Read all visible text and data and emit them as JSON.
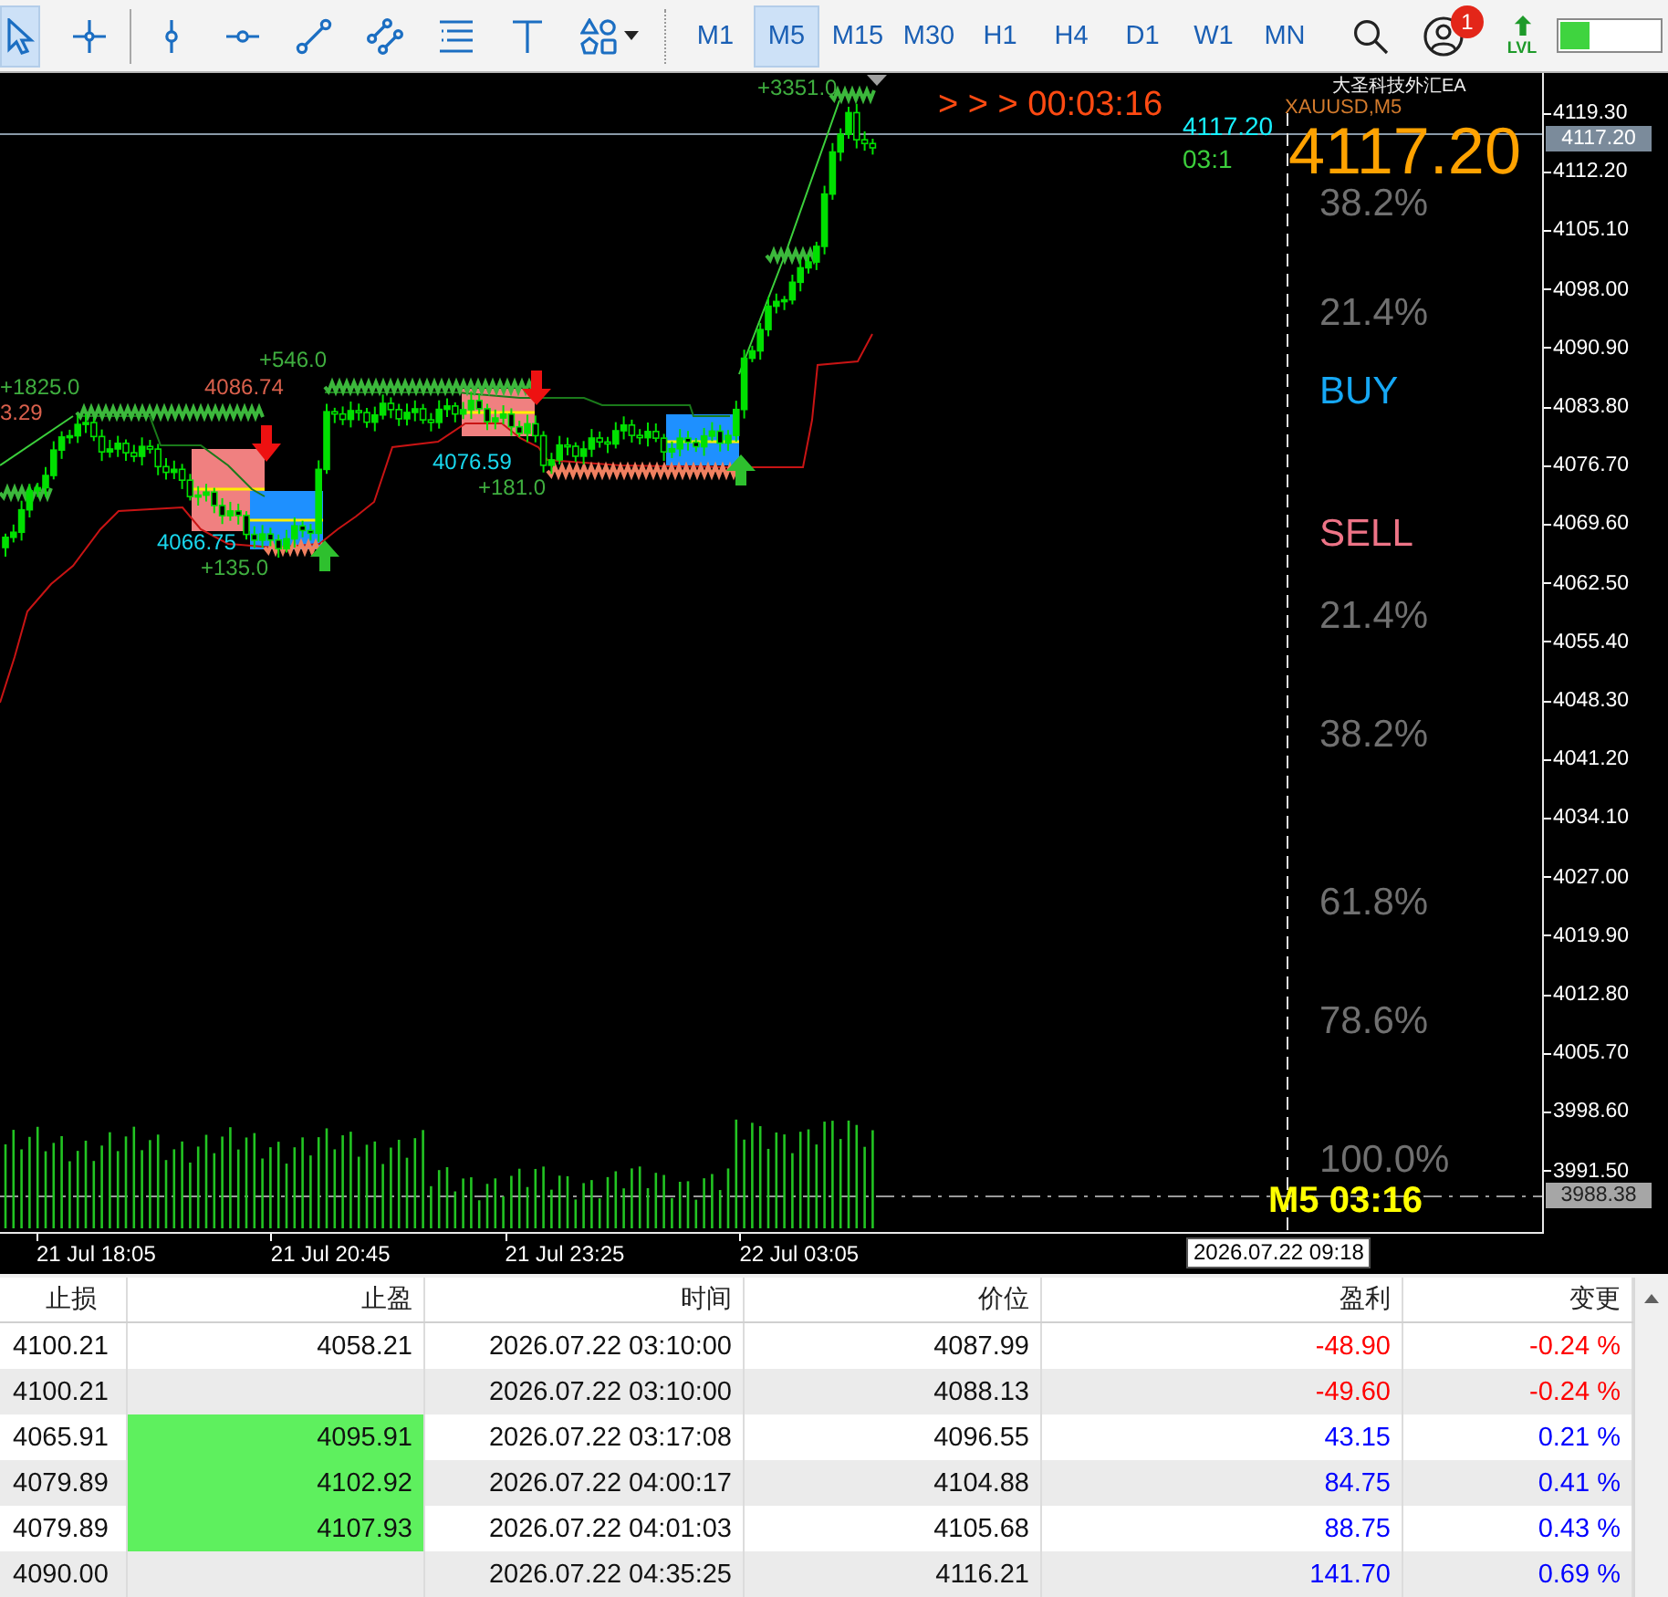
{
  "toolbar": {
    "tools": [
      {
        "kind": "cursor",
        "selected": true
      },
      {
        "kind": "crosshair",
        "selected": false
      },
      {
        "kind": "vertical-line",
        "selected": false
      },
      {
        "kind": "horizontal-line",
        "selected": false
      },
      {
        "kind": "trend-line",
        "selected": false
      },
      {
        "kind": "channel",
        "selected": false
      },
      {
        "kind": "fibonacci",
        "selected": false
      },
      {
        "kind": "text",
        "selected": false
      },
      {
        "kind": "shapes",
        "selected": false
      }
    ],
    "timeframes": [
      {
        "label": "M1",
        "selected": false
      },
      {
        "label": "M5",
        "selected": true
      },
      {
        "label": "M15",
        "selected": false
      },
      {
        "label": "M30",
        "selected": false
      },
      {
        "label": "H1",
        "selected": false
      },
      {
        "label": "H4",
        "selected": false
      },
      {
        "label": "D1",
        "selected": false
      },
      {
        "label": "W1",
        "selected": false
      },
      {
        "label": "MN",
        "selected": false
      }
    ],
    "notification_count": "1",
    "level_button": {
      "label": "LVL"
    },
    "meter": {
      "level": 0.3
    }
  },
  "chart": {
    "countdown": "> > > 00:03:16",
    "ea_name": "大圣科技外汇EA",
    "symbol": "XAUUSD,M5",
    "bid": "4117.20",
    "bar_timer": "03:1",
    "price": "4117.20",
    "timeframe_timer": "M5 03:16",
    "trade_labels": [
      {
        "text": "+3351.0",
        "kind": "profit"
      },
      {
        "text": "+1825.0",
        "kind": "profit"
      },
      {
        "text": "3.29",
        "kind": "stop"
      },
      {
        "text": "+546.0",
        "kind": "profit"
      },
      {
        "text": "4086.74",
        "kind": "stop"
      },
      {
        "text": "4076.59",
        "kind": "entry"
      },
      {
        "text": "+181.0",
        "kind": "profit"
      },
      {
        "text": "4066.75",
        "kind": "entry"
      },
      {
        "text": "+135.0",
        "kind": "profit"
      }
    ],
    "levels": [
      {
        "text": "38.2%",
        "kind": "fib"
      },
      {
        "text": "21.4%",
        "kind": "fib"
      },
      {
        "text": "BUY",
        "kind": "buy"
      },
      {
        "text": "SELL",
        "kind": "sell"
      },
      {
        "text": "21.4%",
        "kind": "fib"
      },
      {
        "text": "38.2%",
        "kind": "fib"
      },
      {
        "text": "61.8%",
        "kind": "fib"
      },
      {
        "text": "78.6%",
        "kind": "fib"
      },
      {
        "text": "100.0%",
        "kind": "fib"
      }
    ]
  },
  "price_axis": {
    "labels": [
      "4119.30",
      "4112.20",
      "4105.10",
      "4098.00",
      "4090.90",
      "4083.80",
      "4076.70",
      "4069.60",
      "4062.50",
      "4055.40",
      "4048.30",
      "4041.20",
      "4034.10",
      "4027.00",
      "4019.90",
      "4012.80",
      "4005.70",
      "3998.60",
      "3991.50"
    ],
    "current_price": "4117.20",
    "marker_price": "3988.38"
  },
  "time_axis": {
    "labels": [
      "21 Jul 18:05",
      "21 Jul 20:45",
      "21 Jul 23:25",
      "22 Jul 03:05"
    ],
    "cursor_time": "2026.07.22 09:18"
  },
  "table": {
    "columns": [
      "止损",
      "止盈",
      "时间",
      "价位",
      "盈利",
      "变更"
    ],
    "rows": [
      {
        "sl": "4100.21",
        "tp": "4058.21",
        "tp_highlighted": false,
        "time": "2026.07.22 03:10:00",
        "price": "4087.99",
        "profit": "-48.90",
        "change": "-0.24 %",
        "color": "#ff0000"
      },
      {
        "sl": "4100.21",
        "tp_highlighted": false,
        "time": "2026.07.22 03:10:00",
        "price": "4088.13",
        "profit": "-49.60",
        "change": "-0.24 %",
        "color": "#ff0000"
      },
      {
        "sl": "4065.91",
        "tp": "4095.91",
        "tp_highlighted": true,
        "time": "2026.07.22 03:17:08",
        "price": "4096.55",
        "profit": "43.15",
        "change": "0.21 %",
        "color": "#0000ff"
      },
      {
        "sl": "4079.89",
        "tp": "4102.92",
        "tp_highlighted": true,
        "time": "2026.07.22 04:00:17",
        "price": "4104.88",
        "profit": "84.75",
        "change": "0.41 %",
        "color": "#0000ff"
      },
      {
        "sl": "4079.89",
        "tp": "4107.93",
        "tp_highlighted": true,
        "time": "2026.07.22 04:01:03",
        "price": "4105.68",
        "profit": "88.75",
        "change": "0.43 %",
        "color": "#0000ff"
      },
      {
        "sl": "4090.00",
        "tp_highlighted": false,
        "time": "2026.07.22 04:35:25",
        "price": "4116.21",
        "profit": "141.70",
        "change": "0.69 %",
        "color": "#0000ff"
      }
    ]
  }
}
